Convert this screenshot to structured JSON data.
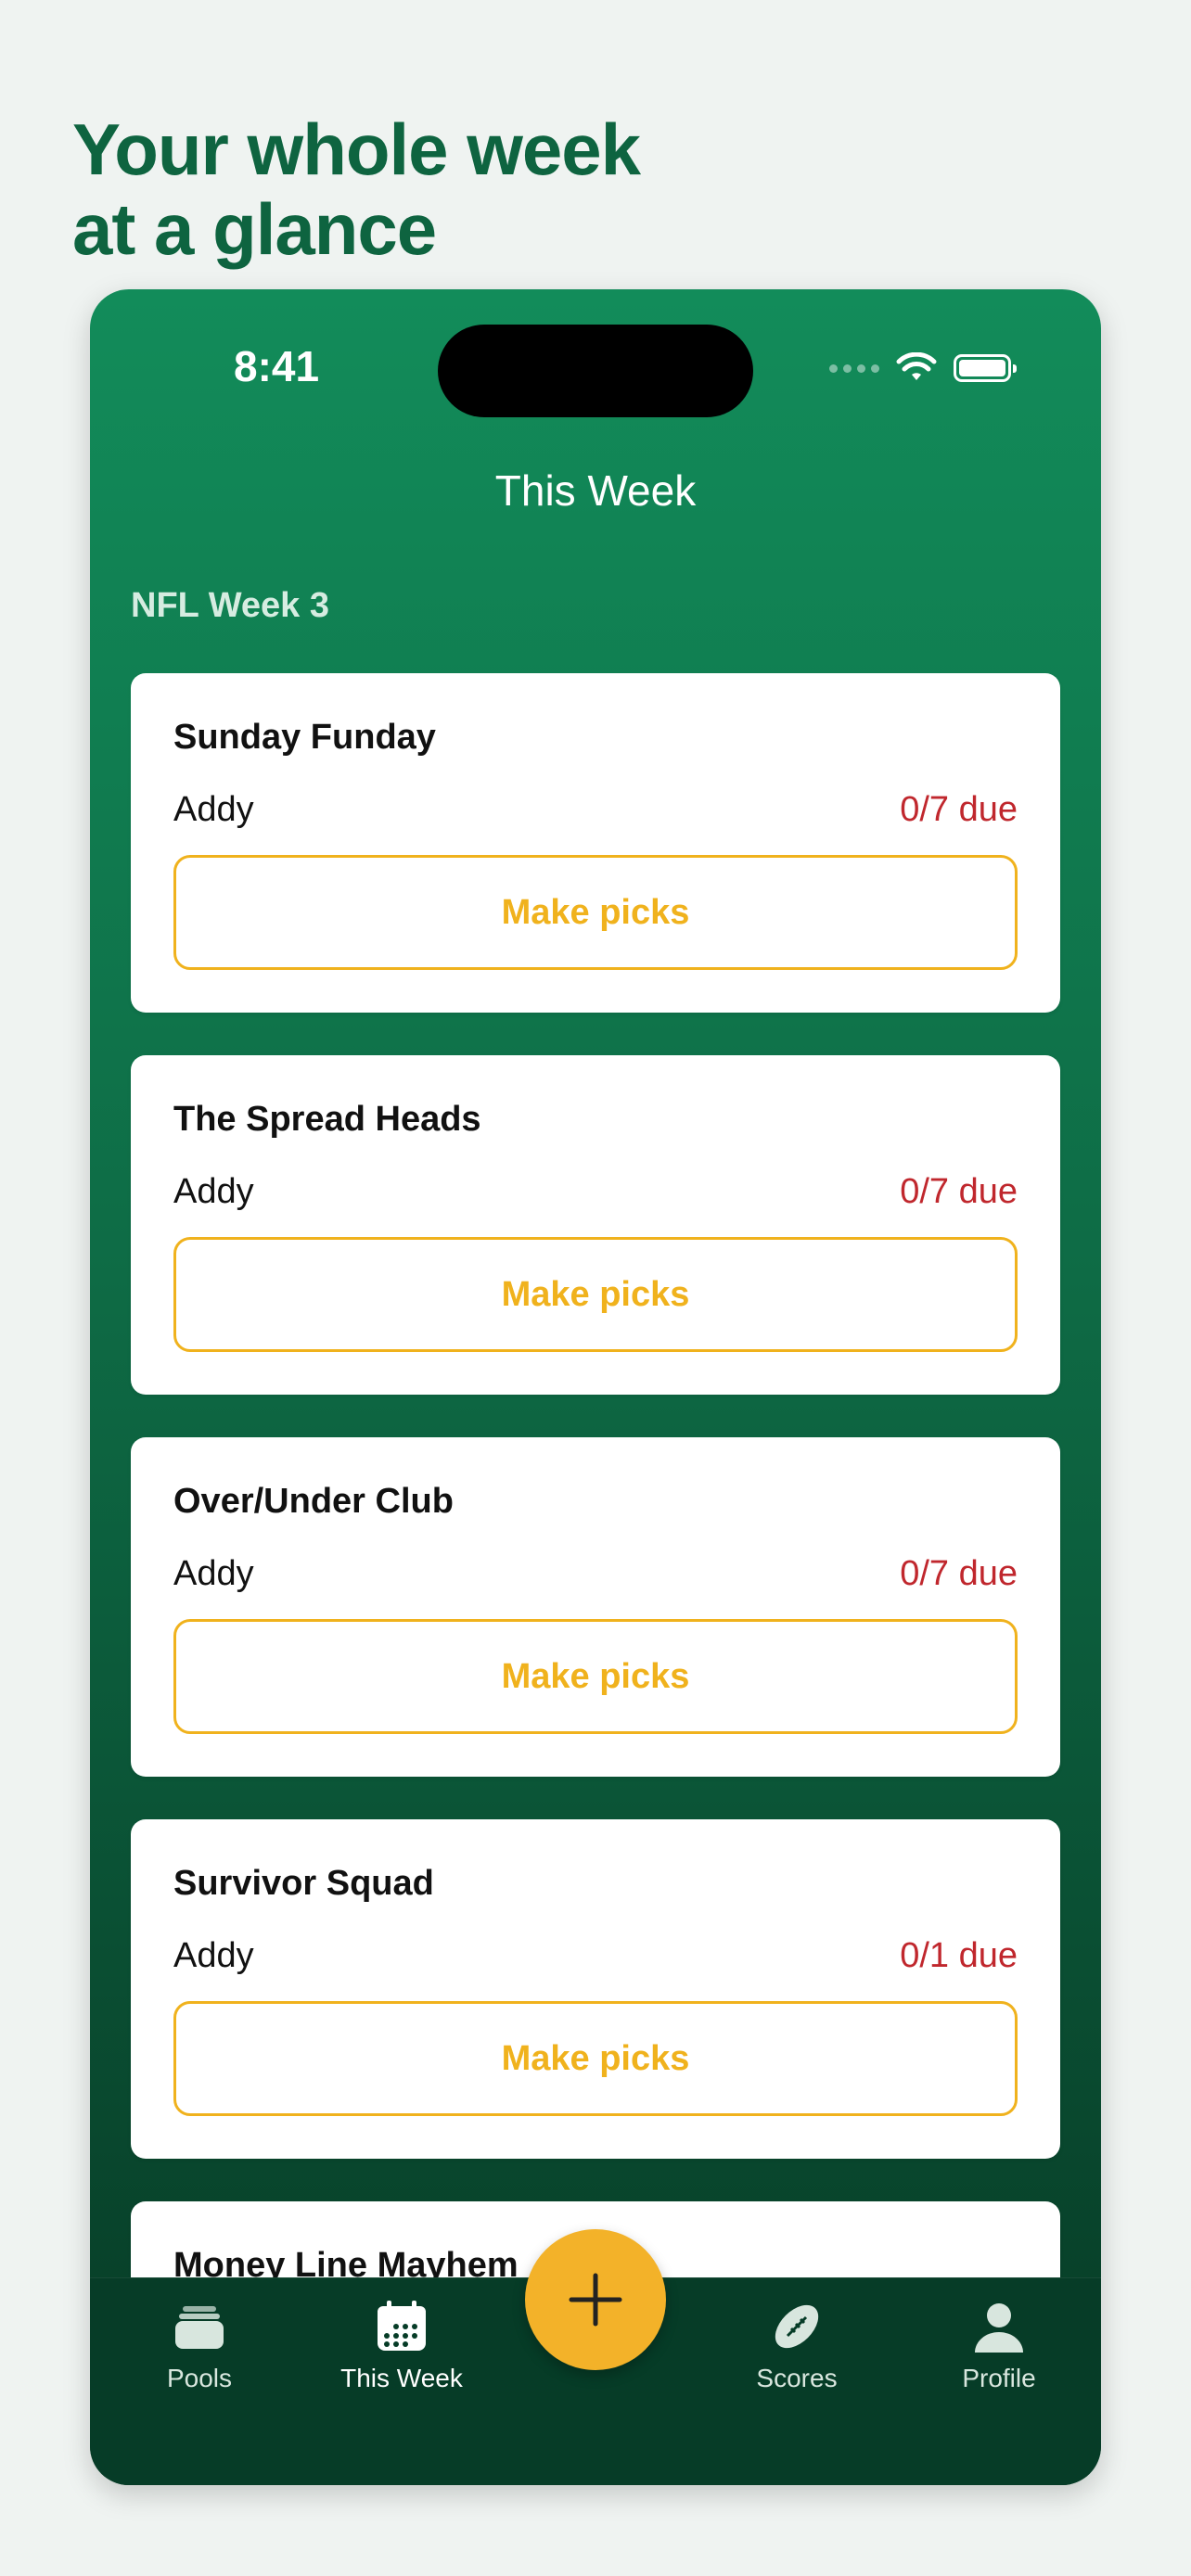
{
  "headline": {
    "line1": "Your whole week",
    "line2": "at a glance"
  },
  "status_bar": {
    "time": "8:41"
  },
  "nav": {
    "title": "This Week"
  },
  "section": {
    "label": "NFL Week 3"
  },
  "pools": [
    {
      "name": "Sunday Funday",
      "owner": "Addy",
      "due": "0/7 due",
      "action": "Make picks"
    },
    {
      "name": "The Spread Heads",
      "owner": "Addy",
      "due": "0/7 due",
      "action": "Make picks"
    },
    {
      "name": "Over/Under Club",
      "owner": "Addy",
      "due": "0/7 due",
      "action": "Make picks"
    },
    {
      "name": "Survivor Squad",
      "owner": "Addy",
      "due": "0/1 due",
      "action": "Make picks"
    },
    {
      "name": "Money Line Mayhem"
    }
  ],
  "tabbar": {
    "pools": "Pools",
    "this_week": "This Week",
    "scores": "Scores",
    "profile": "Profile"
  },
  "colors": {
    "brand_green": "#0e6440",
    "accent_gold": "#f0b21d",
    "due_red": "#c0272d"
  },
  "icons": {
    "fab": "plus-icon",
    "pools": "stack-icon",
    "this_week": "calendar-icon",
    "scores": "football-icon",
    "profile": "person-icon"
  }
}
